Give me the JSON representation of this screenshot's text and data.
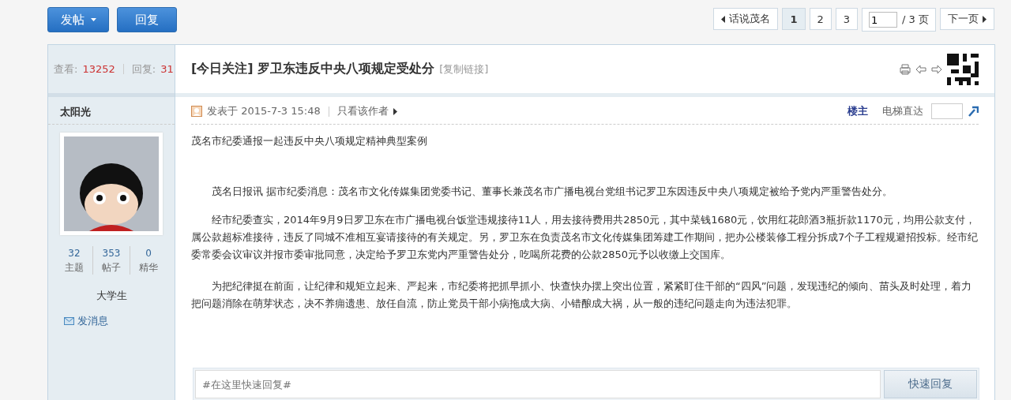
{
  "toolbar": {
    "post_button": "发帖",
    "reply_button": "回复"
  },
  "pager": {
    "back": "话说茂名",
    "pages": [
      {
        "label": "1",
        "selected": true
      },
      {
        "label": "2",
        "selected": false
      },
      {
        "label": "3",
        "selected": false
      }
    ],
    "page_input": "1",
    "total": "/ 3 页",
    "next": "下一页"
  },
  "thread": {
    "views_label": "查看:",
    "views": "13252",
    "replies_label": "回复:",
    "replies": "31",
    "tag": "[今日关注]",
    "title": "罗卫东违反中央八项规定受处分",
    "copy_link": "[复制链接]"
  },
  "author": {
    "name": "太阳光",
    "stats": [
      {
        "value": "32",
        "label": "主题"
      },
      {
        "value": "353",
        "label": "帖子"
      },
      {
        "value": "0",
        "label": "精华"
      }
    ],
    "rank": "大学生",
    "message": "发消息"
  },
  "post": {
    "posted": "发表于 2015-7-3 15:48",
    "only_author": "只看该作者",
    "floor": "楼主",
    "jump_label": "电梯直达",
    "paragraphs": [
      "茂名市纪委通报一起违反中央八项规定精神典型案例",
      "茂名日报讯 据市纪委消息：茂名市文化传媒集团党委书记、董事长兼茂名市广播电视台党组书记罗卫东因违反中央八项规定被给予党内严重警告处分。",
      "经市纪委查实，2014年9月9日罗卫东在市广播电视台饭堂违规接待11人，用去接待费用共2850元，其中菜钱1680元，饮用红花郎酒3瓶折款1170元，均用公款支付，属公款超标准接待，违反了同城不准相互宴请接待的有关规定。另，罗卫东在负责茂名市文化传媒集团筹建工作期间，把办公楼装修工程分拆成7个子工程规避招投标。经市纪委常委会议审议并报市委审批同意，决定给予罗卫东党内严重警告处分，吃喝所花费的公款2850元予以收缴上交国库。",
      "为把纪律挺在前面，让纪律和规矩立起来、严起来，市纪委将把抓早抓小、快查快办摆上突出位置，紧紧盯住干部的“四风”问题，发现违纪的倾向、苗头及时处理，着力把问题消除在萌芽状态，决不养痈遗患、放任自流，防止党员干部小病拖成大病、小错酿成大祸，从一般的违纪问题走向为违法犯罪。"
    ]
  },
  "quick_reply": {
    "placeholder": "#在这里快速回复#",
    "button": "快速回复"
  }
}
